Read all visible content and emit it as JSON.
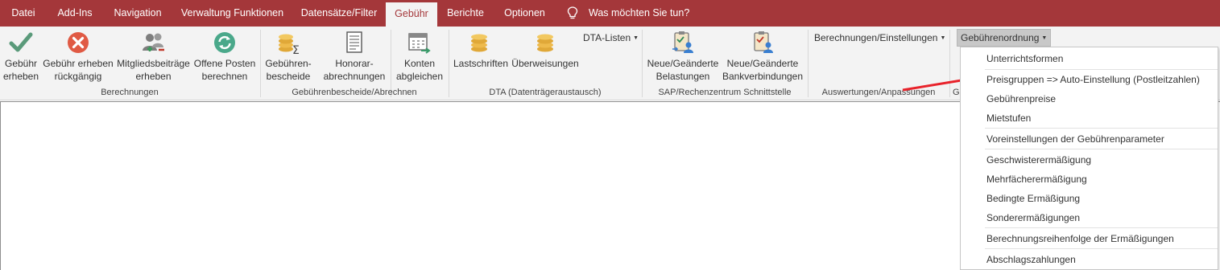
{
  "tabs": [
    {
      "label": "Datei",
      "active": false
    },
    {
      "label": "Add-Ins",
      "active": false
    },
    {
      "label": "Navigation",
      "active": false
    },
    {
      "label": "Verwaltung Funktionen",
      "active": false
    },
    {
      "label": "Datensätze/Filter",
      "active": false
    },
    {
      "label": "Gebühr",
      "active": true
    },
    {
      "label": "Berichte",
      "active": false
    },
    {
      "label": "Optionen",
      "active": false
    }
  ],
  "tell_me": {
    "icon": "lightbulb-icon",
    "label": "Was möchten Sie tun?"
  },
  "ribbon": {
    "berechnungen": {
      "group_label": "Berechnungen",
      "buttons": [
        {
          "label": "Gebühr\nerheben",
          "icon": "checkmark-icon"
        },
        {
          "label": "Gebühr erheben\nrückgängig",
          "icon": "cancel-x-icon"
        },
        {
          "label": "Mitgliedsbeiträge\nerheben",
          "icon": "members-icon"
        },
        {
          "label": "Offene Posten\nberechnen",
          "icon": "refresh-icon"
        }
      ]
    },
    "bescheide": {
      "group_label": "Gebührenbescheide/Abrechnen",
      "buttons": [
        {
          "label": "Gebühren-\nbescheide",
          "icon": "coins-sigma-icon"
        },
        {
          "label": "Honorar-\nabrechnungen",
          "icon": "document-icon"
        },
        {
          "label": "Konten\nabgleichen",
          "icon": "calendar-arrow-icon"
        }
      ]
    },
    "dta": {
      "group_label": "DTA (Datenträgeraustausch)",
      "buttons": [
        {
          "label": "Lastschriften",
          "icon": "coins-icon"
        },
        {
          "label": "Überweisungen",
          "icon": "coins-icon"
        }
      ],
      "dropdown": "DTA-Listen"
    },
    "sap": {
      "group_label": "SAP/Rechenzentrum Schnittstelle",
      "buttons": [
        {
          "label": "Neue/Geänderte\nBelastungen",
          "icon": "clipboard-person-icon"
        },
        {
          "label": "Neue/Geänderte\nBankverbindungen",
          "icon": "clipboard-person-icon"
        }
      ]
    },
    "auswertungen": {
      "group_label": "Auswertungen/Anpassungen",
      "dropdown": "Berechnungen/Einstellungen"
    },
    "gebuehrenordnung": {
      "group_label_partial": "G",
      "dropdown": "Gebührenordnung"
    }
  },
  "dropdown_menu": {
    "items": [
      "Unterrichtsformen",
      "Preisgruppen => Auto-Einstellung (Postleitzahlen)",
      "Gebührenpreise",
      "Mietstufen",
      "Voreinstellungen der Gebührenparameter",
      "Geschwisterermäßigung",
      "Mehrfächerermäßigung",
      "Bedingte Ermäßigung",
      "Sonderermäßigungen",
      "Berechnungsreihenfolge der Ermäßigungen",
      "Abschlagszahlungen"
    ]
  },
  "colors": {
    "accent": "#a4373a",
    "annotation_arrow": "#e8222a",
    "ribbon_bg": "#f3f3f3"
  }
}
